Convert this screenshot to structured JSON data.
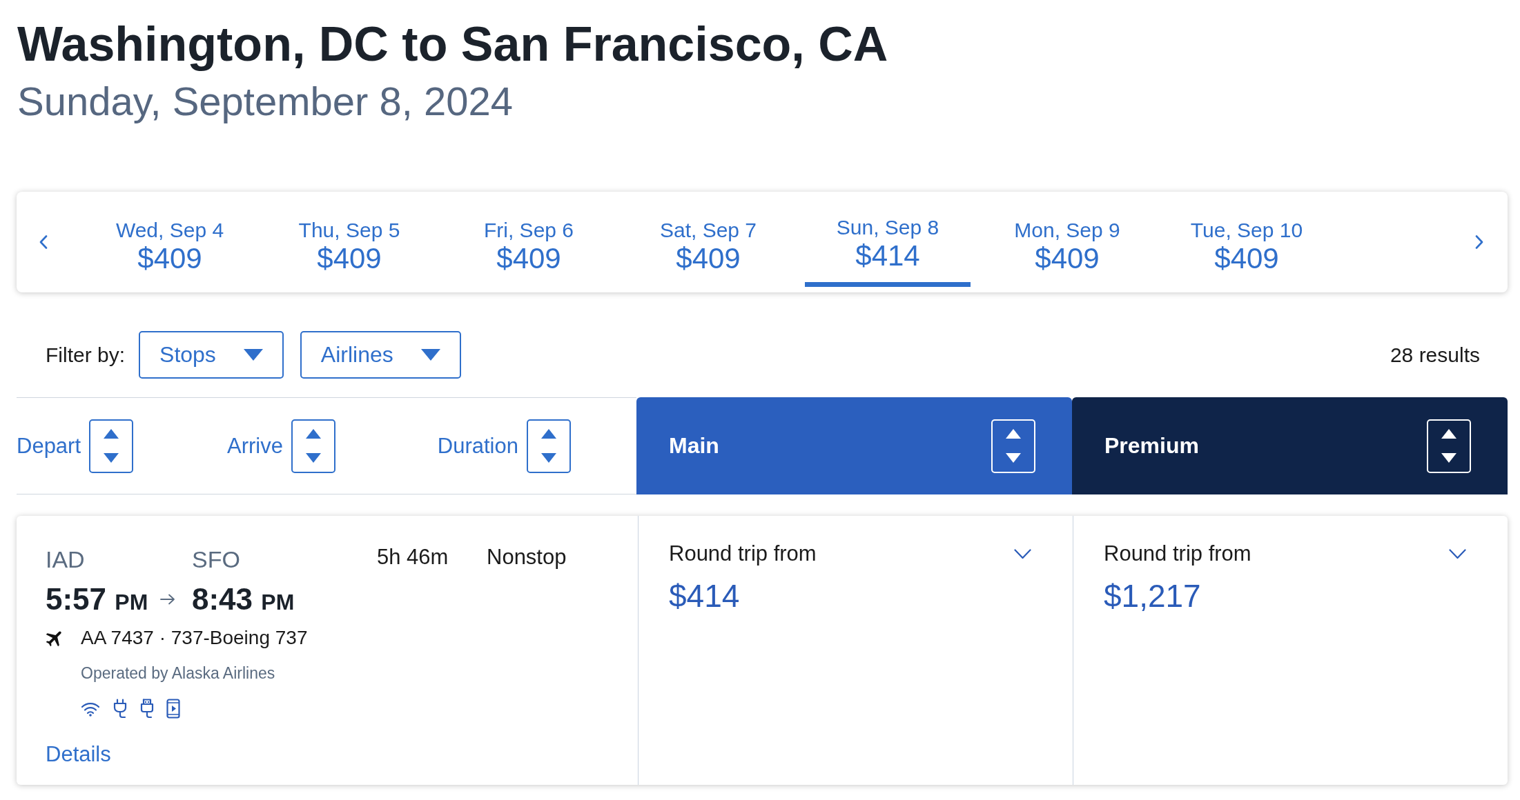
{
  "header": {
    "route": "Washington, DC to San Francisco, CA",
    "date": "Sunday, September 8, 2024"
  },
  "date_strip": {
    "dates": [
      {
        "label": "Wed, Sep 4",
        "price": "$409",
        "selected": false
      },
      {
        "label": "Thu, Sep 5",
        "price": "$409",
        "selected": false
      },
      {
        "label": "Fri, Sep 6",
        "price": "$409",
        "selected": false
      },
      {
        "label": "Sat, Sep 7",
        "price": "$409",
        "selected": false
      },
      {
        "label": "Sun, Sep 8",
        "price": "$414",
        "selected": true
      },
      {
        "label": "Mon, Sep 9",
        "price": "$409",
        "selected": false
      },
      {
        "label": "Tue, Sep 10",
        "price": "$409",
        "selected": false
      }
    ]
  },
  "filters": {
    "label": "Filter by:",
    "dropdowns": [
      "Stops",
      "Airlines"
    ],
    "results": "28 results"
  },
  "sort_columns": [
    "Depart",
    "Arrive",
    "Duration"
  ],
  "cabins": [
    {
      "name": "Main",
      "color": "#2b5fbe"
    },
    {
      "name": "Premium",
      "color": "#0f2449"
    }
  ],
  "flights": [
    {
      "origin": "IAD",
      "destination": "SFO",
      "depart_time": "5:57",
      "depart_period": "PM",
      "arrive_time": "8:43",
      "arrive_period": "PM",
      "duration": "5h 46m",
      "stops": "Nonstop",
      "flight_info": "AA 7437 · 737-Boeing 737",
      "operator": "Operated by Alaska Airlines",
      "details_link": "Details",
      "fares": [
        {
          "label": "Round trip from",
          "price": "$414"
        },
        {
          "label": "Round trip from",
          "price": "$1,217"
        }
      ]
    }
  ]
}
